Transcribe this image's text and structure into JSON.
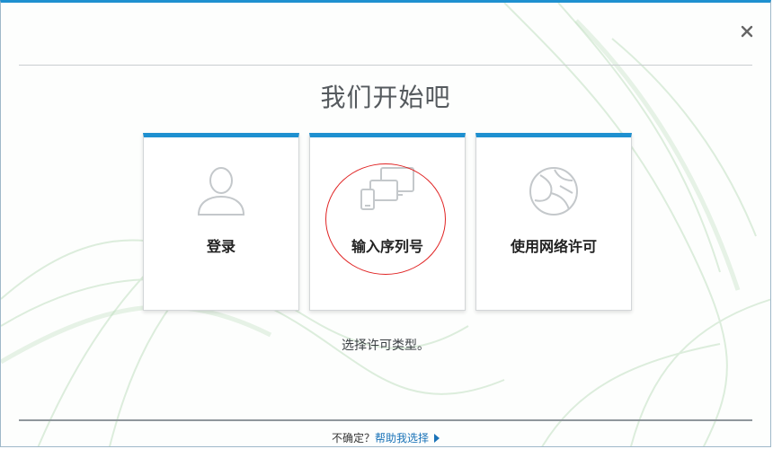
{
  "dialog": {
    "title": "我们开始吧",
    "subtitle": "选择许可类型。",
    "close_icon": "close-icon"
  },
  "cards": [
    {
      "label": "登录",
      "icon": "user-icon"
    },
    {
      "label": "输入序列号",
      "icon": "devices-icon"
    },
    {
      "label": "使用网络许可",
      "icon": "network-globe-icon"
    }
  ],
  "footer": {
    "prefix": "不确定？",
    "link": "帮助我选择",
    "arrow_icon": "triangle-right-icon"
  },
  "colors": {
    "accent": "#1e90d0",
    "link": "#1a73b8",
    "highlight": "#e02424"
  }
}
